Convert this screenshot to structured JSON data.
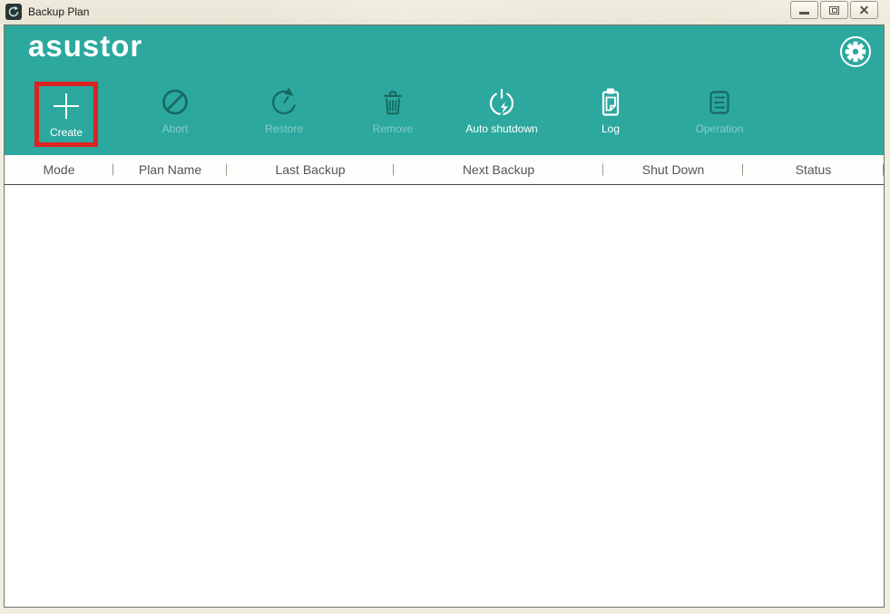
{
  "window": {
    "title": "Backup Plan",
    "app_icon": "backup-app-icon",
    "controls": [
      {
        "name": "minimize"
      },
      {
        "name": "maximize"
      },
      {
        "name": "close"
      }
    ]
  },
  "header": {
    "logo_text": "asustor",
    "settings_icon": "gear-icon"
  },
  "toolbar": {
    "items": [
      {
        "label": "Create",
        "icon": "plus-icon",
        "state": "enabled",
        "highlighted": true
      },
      {
        "label": "Abort",
        "icon": "abort-icon",
        "state": "disabled",
        "highlighted": false
      },
      {
        "label": "Restore",
        "icon": "restore-icon",
        "state": "disabled",
        "highlighted": false
      },
      {
        "label": "Remove",
        "icon": "trash-icon",
        "state": "disabled",
        "highlighted": false
      },
      {
        "label": "Auto shutdown",
        "icon": "power-bolt-icon",
        "state": "enabled",
        "highlighted": false
      },
      {
        "label": "Log",
        "icon": "clipboard-icon",
        "state": "enabled",
        "highlighted": false
      },
      {
        "label": "Operation",
        "icon": "sliders-icon",
        "state": "disabled",
        "highlighted": false
      }
    ]
  },
  "table": {
    "columns": [
      "Mode",
      "Plan Name",
      "Last Backup",
      "Next Backup",
      "Shut Down",
      "Status"
    ],
    "rows": []
  },
  "colors": {
    "teal": "#2CA89E",
    "disabled_icon": "#17695F",
    "disabled_label": "#85CDC6",
    "highlight_red": "#DD2222",
    "titlebar_bg": "#F1EEE0",
    "header_text": "#555555"
  }
}
